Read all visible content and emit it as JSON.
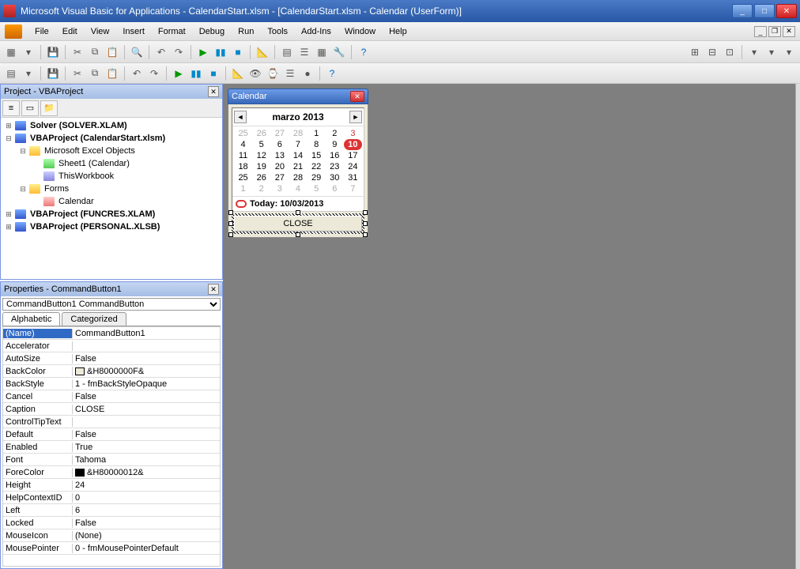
{
  "window": {
    "title": "Microsoft Visual Basic for Applications - CalendarStart.xlsm - [CalendarStart.xlsm - Calendar (UserForm)]"
  },
  "menu": {
    "items": [
      "File",
      "Edit",
      "View",
      "Insert",
      "Format",
      "Debug",
      "Run",
      "Tools",
      "Add-Ins",
      "Window",
      "Help"
    ]
  },
  "project": {
    "title": "Project - VBAProject",
    "nodes": [
      {
        "depth": 0,
        "exp": "+",
        "icon": "prj",
        "label": "Solver (SOLVER.XLAM)",
        "bold": true
      },
      {
        "depth": 0,
        "exp": "-",
        "icon": "prj",
        "label": "VBAProject (CalendarStart.xlsm)",
        "bold": true
      },
      {
        "depth": 1,
        "exp": "-",
        "icon": "fld",
        "label": "Microsoft Excel Objects"
      },
      {
        "depth": 2,
        "exp": "",
        "icon": "sht",
        "label": "Sheet1 (Calendar)"
      },
      {
        "depth": 2,
        "exp": "",
        "icon": "wb",
        "label": "ThisWorkbook"
      },
      {
        "depth": 1,
        "exp": "-",
        "icon": "fld",
        "label": "Forms"
      },
      {
        "depth": 2,
        "exp": "",
        "icon": "frm",
        "label": "Calendar"
      },
      {
        "depth": 0,
        "exp": "+",
        "icon": "prj",
        "label": "VBAProject (FUNCRES.XLAM)",
        "bold": true
      },
      {
        "depth": 0,
        "exp": "+",
        "icon": "prj",
        "label": "VBAProject (PERSONAL.XLSB)",
        "bold": true
      }
    ]
  },
  "props": {
    "title": "Properties - CommandButton1",
    "object": "CommandButton1 CommandButton",
    "tabs": {
      "alpha": "Alphabetic",
      "cat": "Categorized"
    },
    "rows": [
      {
        "n": "(Name)",
        "v": "CommandButton1",
        "sel": true
      },
      {
        "n": "Accelerator",
        "v": ""
      },
      {
        "n": "AutoSize",
        "v": "False"
      },
      {
        "n": "BackColor",
        "v": "&H8000000F&",
        "sw": "#ece9d8"
      },
      {
        "n": "BackStyle",
        "v": "1 - fmBackStyleOpaque"
      },
      {
        "n": "Cancel",
        "v": "False"
      },
      {
        "n": "Caption",
        "v": "CLOSE"
      },
      {
        "n": "ControlTipText",
        "v": ""
      },
      {
        "n": "Default",
        "v": "False"
      },
      {
        "n": "Enabled",
        "v": "True"
      },
      {
        "n": "Font",
        "v": "Tahoma"
      },
      {
        "n": "ForeColor",
        "v": "&H80000012&",
        "sw": "#000000"
      },
      {
        "n": "Height",
        "v": "24"
      },
      {
        "n": "HelpContextID",
        "v": "0"
      },
      {
        "n": "Left",
        "v": "6"
      },
      {
        "n": "Locked",
        "v": "False"
      },
      {
        "n": "MouseIcon",
        "v": "(None)"
      },
      {
        "n": "MousePointer",
        "v": "0 - fmMousePointerDefault"
      }
    ]
  },
  "form": {
    "title": "Calendar",
    "month": "marzo 2013",
    "today_label": "Today: 10/03/2013",
    "close_label": "CLOSE",
    "days": [
      {
        "d": "25",
        "g": true
      },
      {
        "d": "26",
        "g": true
      },
      {
        "d": "27",
        "g": true
      },
      {
        "d": "28",
        "g": true
      },
      {
        "d": "1"
      },
      {
        "d": "2"
      },
      {
        "d": "3",
        "r": true
      },
      {
        "d": "4"
      },
      {
        "d": "5"
      },
      {
        "d": "6"
      },
      {
        "d": "7"
      },
      {
        "d": "8"
      },
      {
        "d": "9"
      },
      {
        "d": "10",
        "t": true
      },
      {
        "d": "11"
      },
      {
        "d": "12"
      },
      {
        "d": "13"
      },
      {
        "d": "14"
      },
      {
        "d": "15"
      },
      {
        "d": "16"
      },
      {
        "d": "17"
      },
      {
        "d": "18"
      },
      {
        "d": "19"
      },
      {
        "d": "20"
      },
      {
        "d": "21"
      },
      {
        "d": "22"
      },
      {
        "d": "23"
      },
      {
        "d": "24"
      },
      {
        "d": "25"
      },
      {
        "d": "26"
      },
      {
        "d": "27"
      },
      {
        "d": "28"
      },
      {
        "d": "29"
      },
      {
        "d": "30"
      },
      {
        "d": "31"
      },
      {
        "d": "1",
        "g": true
      },
      {
        "d": "2",
        "g": true
      },
      {
        "d": "3",
        "g": true
      },
      {
        "d": "4",
        "g": true
      },
      {
        "d": "5",
        "g": true
      },
      {
        "d": "6",
        "g": true
      },
      {
        "d": "7",
        "g": true
      }
    ]
  }
}
